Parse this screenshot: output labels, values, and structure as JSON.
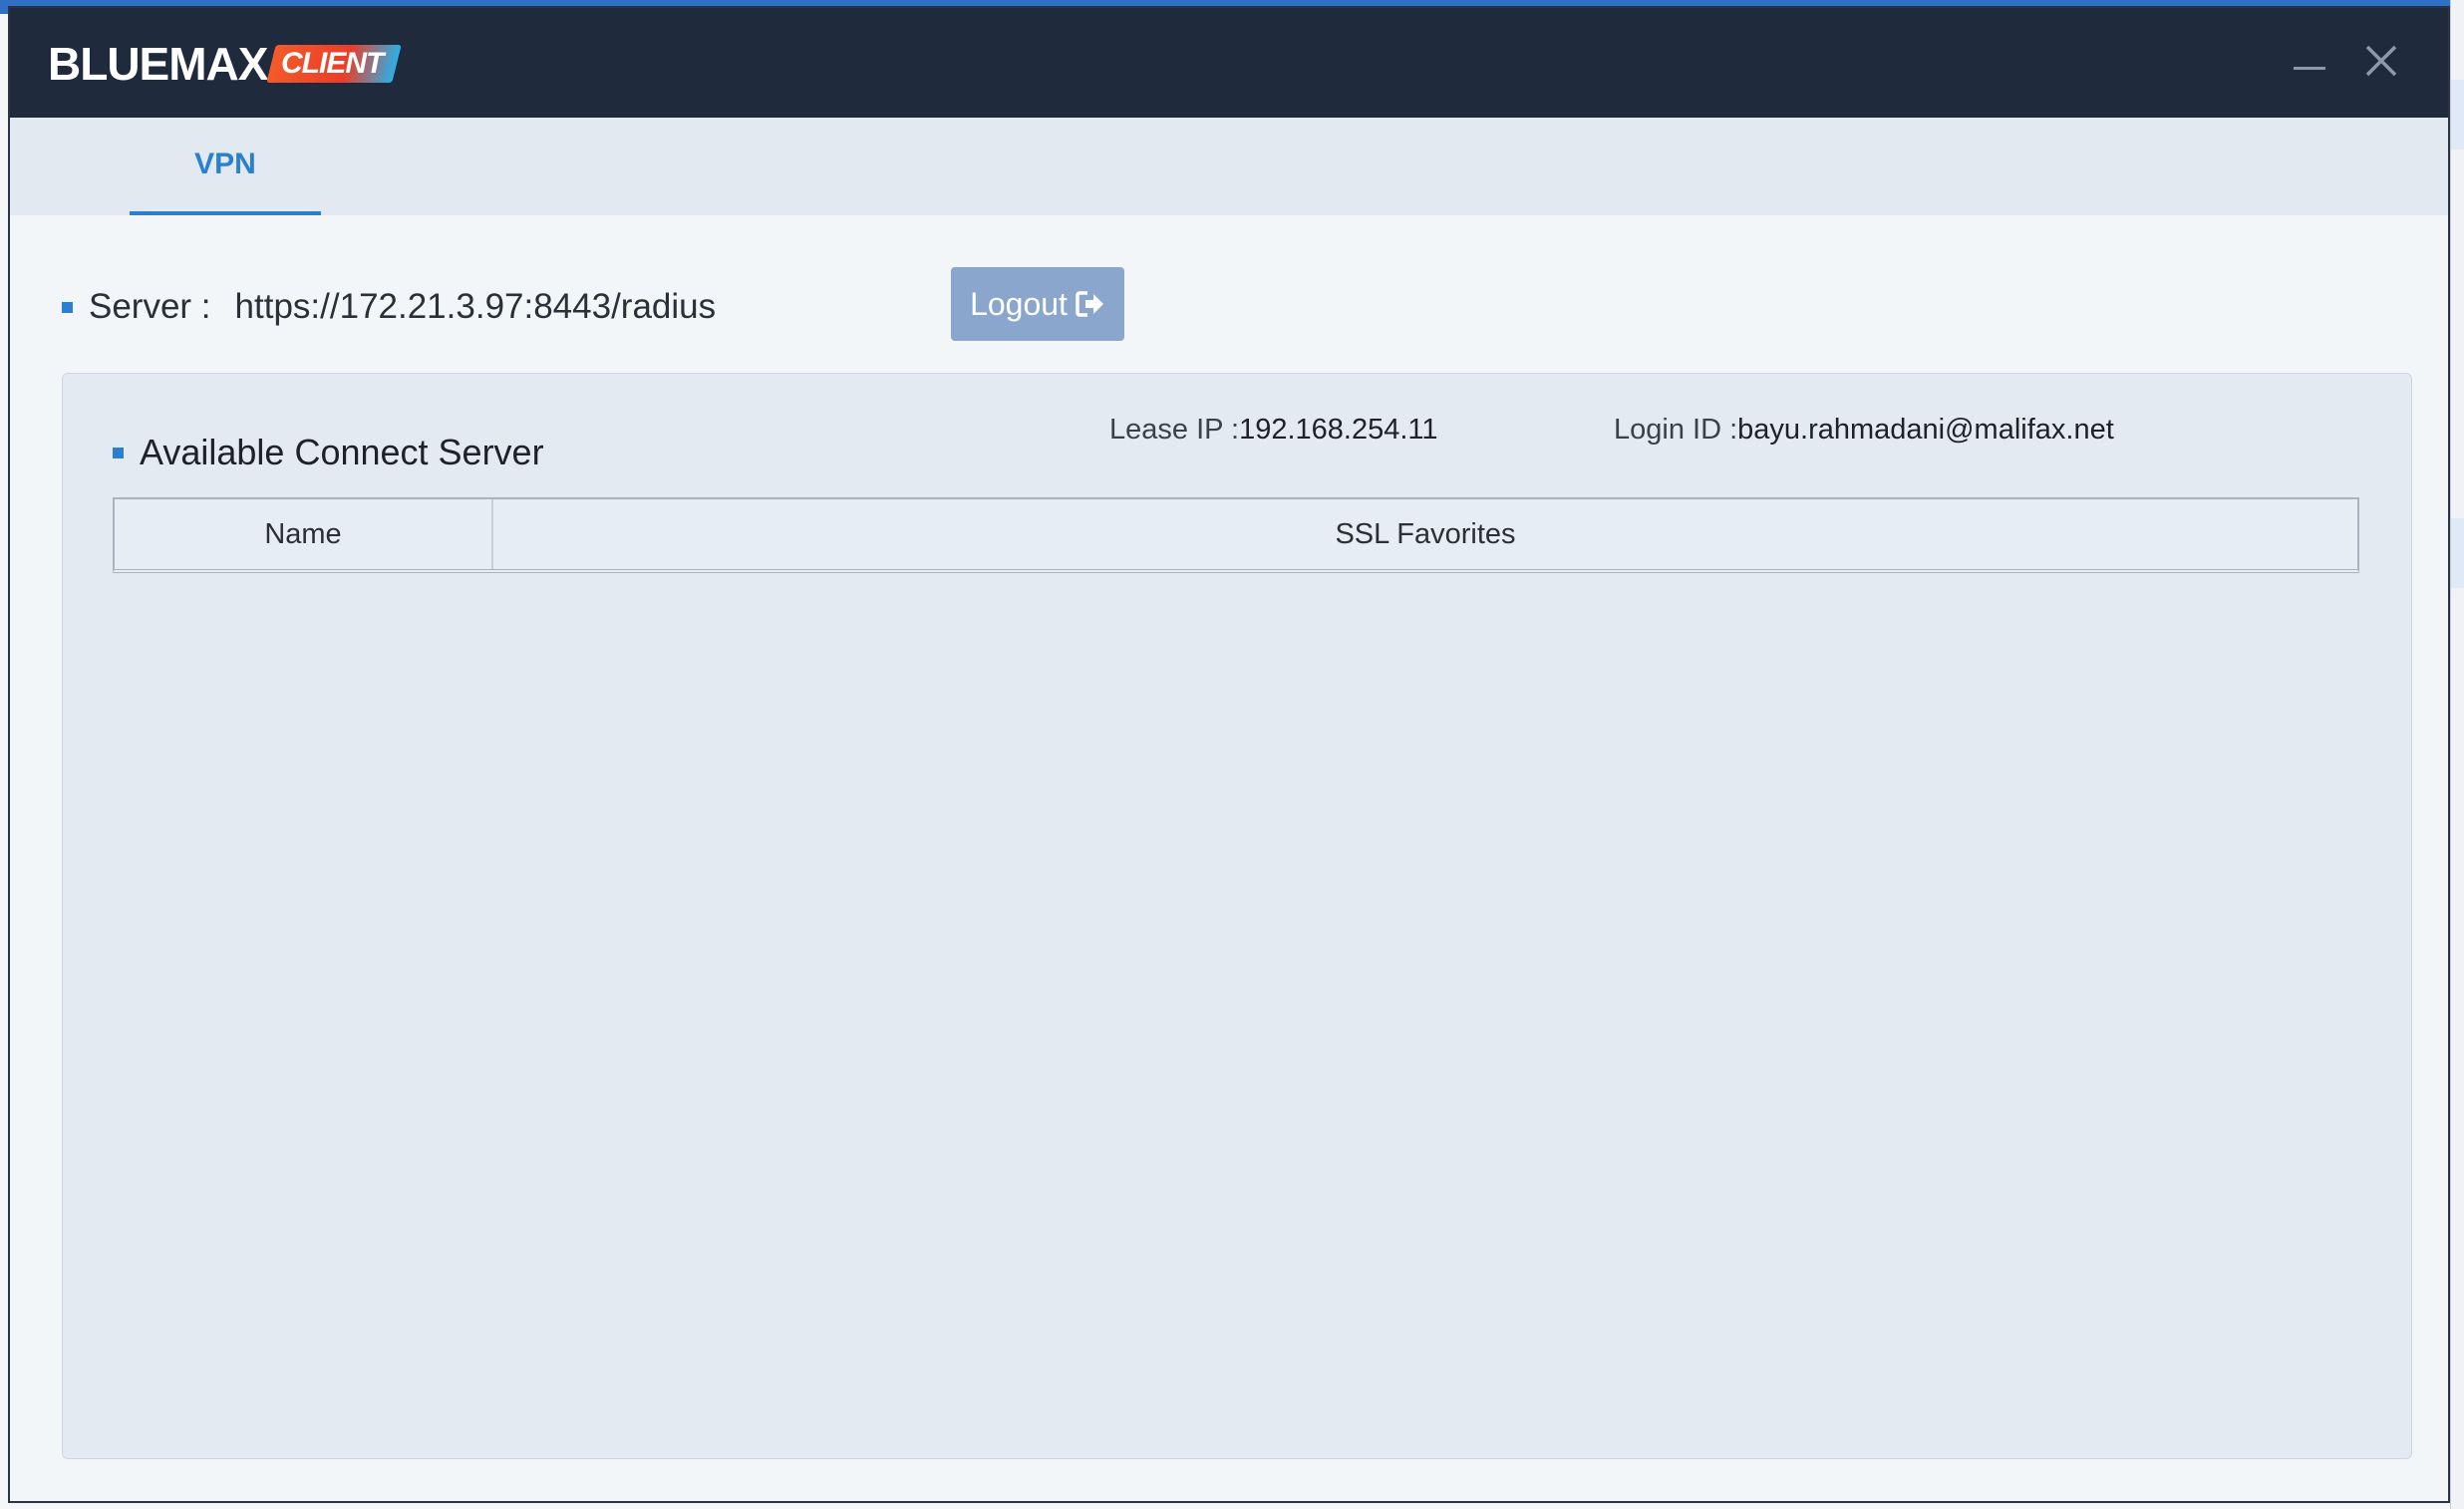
{
  "window": {
    "brand": "BLUEMAX",
    "brand_badge": "CLIENT"
  },
  "tabs": [
    {
      "label": "VPN",
      "active": true
    }
  ],
  "server": {
    "label": "Server :",
    "value": "https://172.21.3.97:8443/radius",
    "logout_label": "Logout"
  },
  "panel": {
    "title": "Available Connect Server",
    "lease_label": "Lease IP :",
    "lease_value": "192.168.254.11",
    "login_label": "Login ID :",
    "login_value": "bayu.rahmadani@malifax.net",
    "columns": [
      "Name",
      "SSL Favorites"
    ],
    "rows": []
  },
  "colors": {
    "titlebar": "#1f2a3d",
    "accent": "#2a7fd0",
    "logout_button": "#8aa6cc"
  },
  "icons": {
    "minimize": "minimize-icon",
    "close": "close-icon",
    "logout": "logout-icon"
  }
}
